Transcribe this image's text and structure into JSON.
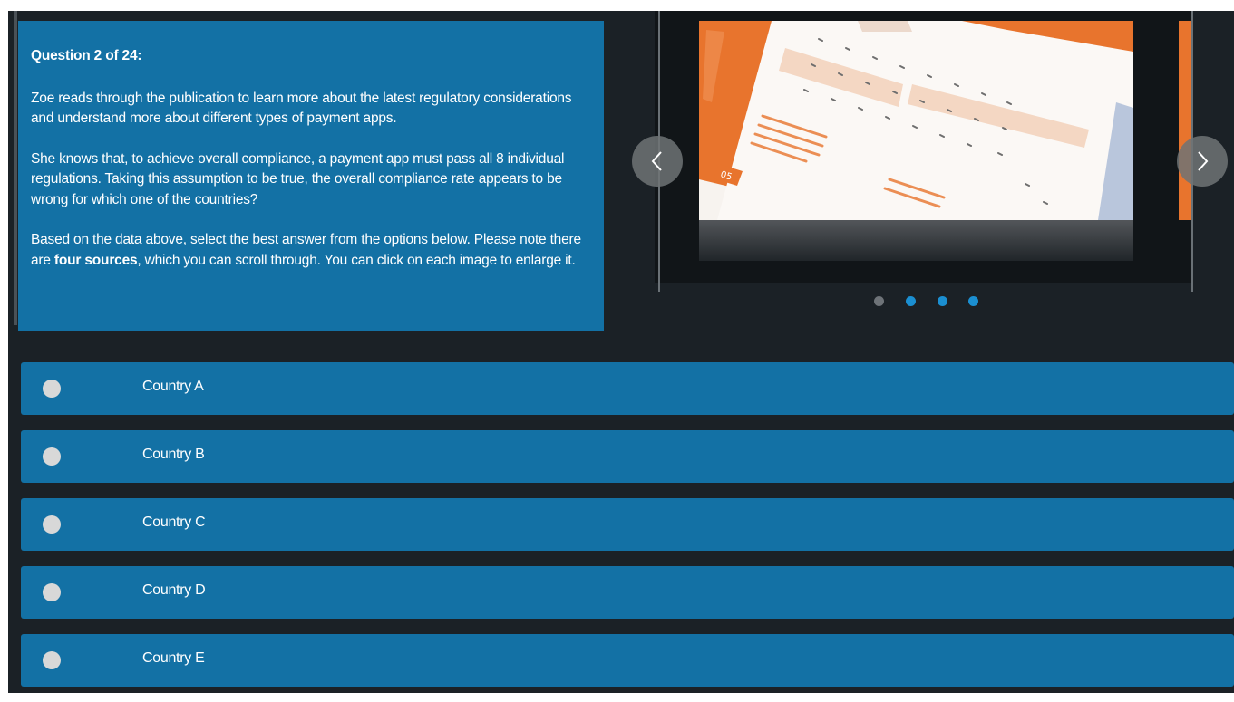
{
  "question": {
    "title": "Question 2 of 24:",
    "para1": "Zoe reads through the publication to learn more about the latest regulatory considerations and understand more about different types of payment apps.",
    "para2": "She knows that, to achieve overall compliance, a payment app must pass all 8 individual regulations. Taking this assumption to be true, the overall compliance rate appears to be wrong for which one of the countries?",
    "para3_before": "Based on the data above, select the best answer from the options below. Please note there are ",
    "para3_bold": "four sources",
    "para3_after": ", which you can scroll through. You can click on each image to enlarge it."
  },
  "carousel": {
    "prev_icon": "chevron-left-icon",
    "next_icon": "chevron-right-icon",
    "page_badge": "05",
    "dots": [
      {
        "active": false,
        "color": "#6e7378"
      },
      {
        "active": true,
        "color": "#1b8fd1"
      },
      {
        "active": true,
        "color": "#1b8fd1"
      },
      {
        "active": true,
        "color": "#1b8fd1"
      }
    ]
  },
  "answers": [
    {
      "label": "Country A"
    },
    {
      "label": "Country B"
    },
    {
      "label": "Country C"
    },
    {
      "label": "Country D"
    },
    {
      "label": "Country E"
    }
  ],
  "colors": {
    "panel": "#1371a5",
    "background": "#1b2126",
    "accent_orange": "#e8742d"
  }
}
